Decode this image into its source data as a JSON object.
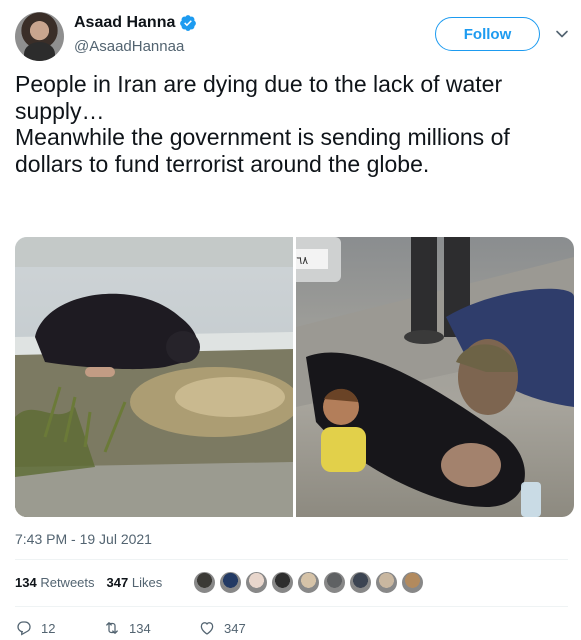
{
  "author": {
    "display_name": "Asaad Hanna",
    "handle": "@AsaadHannaa",
    "verified_icon": "verified-badge-icon"
  },
  "follow_label": "Follow",
  "menu_icon": "chevron-down-icon",
  "tweet_text": "People in Iran are dying due to the lack of water supply…\nMeanwhile the government is sending millions of dollars to fund terrorist around the globe.",
  "media": [
    {
      "icon": "photo-woman-drinking-from-puddle"
    },
    {
      "icon": "photo-woman-lying-on-ground-with-child"
    }
  ],
  "car_plate_text": "٦٨ ١٢",
  "timestamp": "7:43 PM - 19 Jul 2021",
  "stats": {
    "retweets_count": "134",
    "retweets_label": "Retweets",
    "likes_count": "347",
    "likes_label": "Likes"
  },
  "liker_avatars": [
    {
      "color": "#3b3a36"
    },
    {
      "color": "#233a64"
    },
    {
      "color": "#e8d6cc"
    },
    {
      "color": "#2e2e2e"
    },
    {
      "color": "#d6c3a8"
    },
    {
      "color": "#5f6163"
    },
    {
      "color": "#3c4452"
    },
    {
      "color": "#c9b7a0"
    },
    {
      "color": "#b28a5e"
    }
  ],
  "actions": {
    "reply_count": "12",
    "retweet_count": "134",
    "like_count": "347"
  },
  "colors": {
    "accent": "#1d9bf0",
    "text": "#0f1419",
    "secondary": "#536471"
  }
}
